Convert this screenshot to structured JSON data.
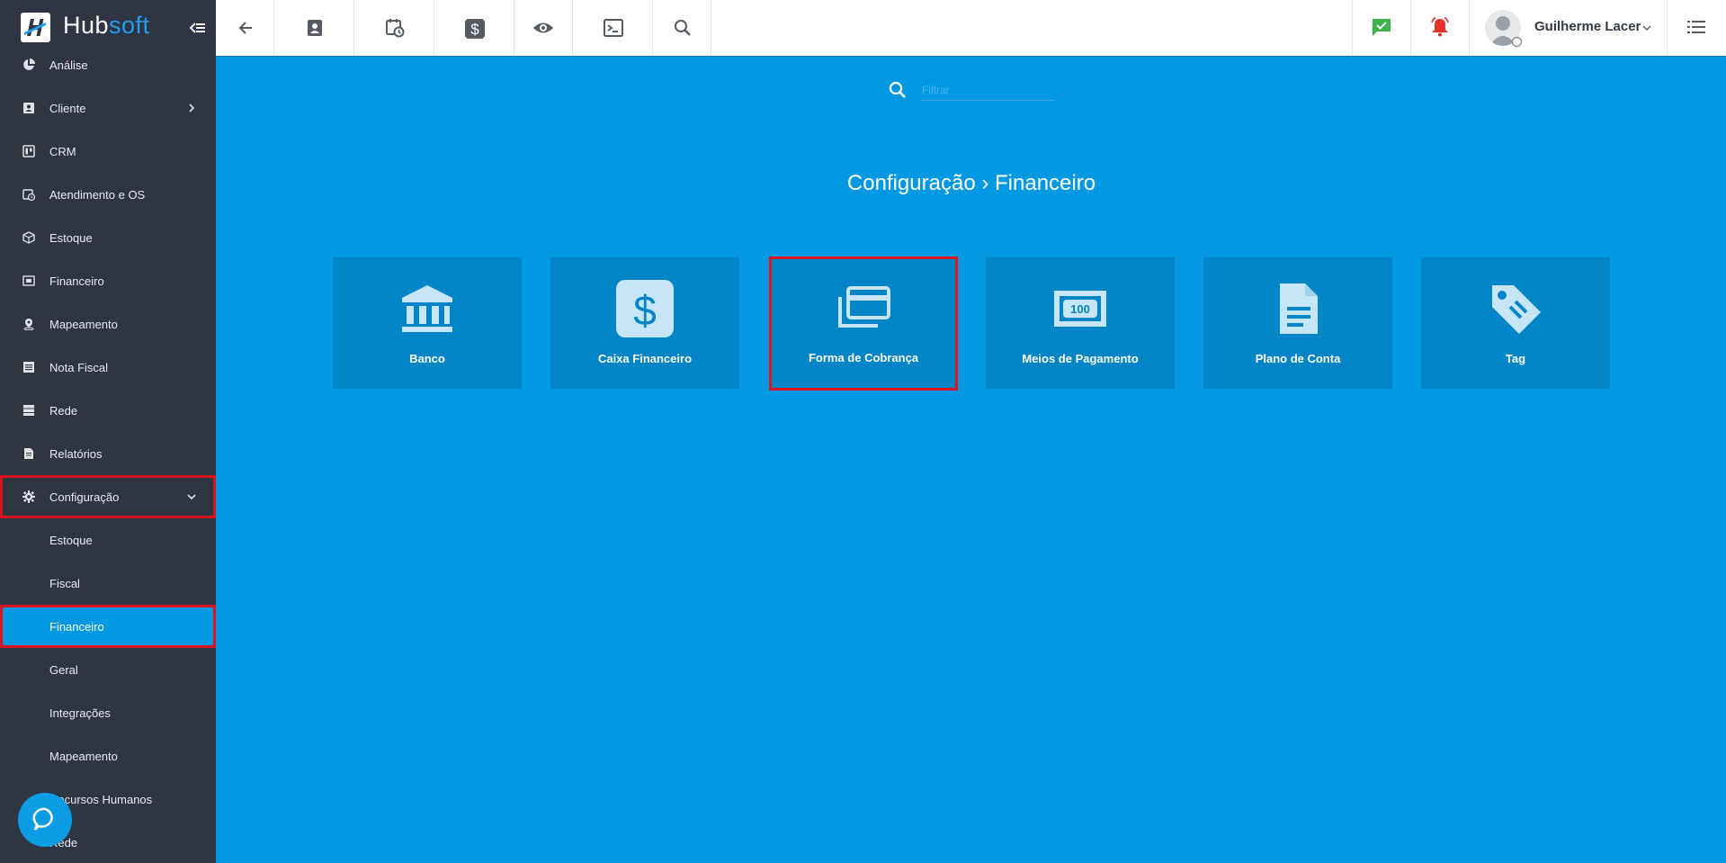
{
  "app": {
    "logo_hub": "Hub",
    "logo_soft": "soft"
  },
  "sidebar": {
    "items": [
      {
        "label": "Análise",
        "icon": "pie-chart-icon"
      },
      {
        "label": "Cliente",
        "icon": "contact-card-icon",
        "has_arrow": true
      },
      {
        "label": "CRM",
        "icon": "board-icon"
      },
      {
        "label": "Atendimento e OS",
        "icon": "calendar-clock-icon"
      },
      {
        "label": "Estoque",
        "icon": "box-icon"
      },
      {
        "label": "Financeiro",
        "icon": "money-icon"
      },
      {
        "label": "Mapeamento",
        "icon": "map-pin-icon"
      },
      {
        "label": "Nota Fiscal",
        "icon": "receipt-icon"
      },
      {
        "label": "Rede",
        "icon": "server-icon"
      },
      {
        "label": "Relatórios",
        "icon": "document-icon"
      },
      {
        "label": "Configuração",
        "icon": "gear-icon",
        "expanded": true
      }
    ],
    "sub_items": [
      {
        "label": "Estoque"
      },
      {
        "label": "Fiscal"
      },
      {
        "label": "Financeiro",
        "active": true
      },
      {
        "label": "Geral"
      },
      {
        "label": "Integrações"
      },
      {
        "label": "Mapeamento"
      },
      {
        "label": "Recursos Humanos"
      },
      {
        "label": "Rede"
      }
    ]
  },
  "topbar": {
    "user_name": "Guilherme Lacer",
    "icons": [
      "back-arrow-icon",
      "contact-card-icon",
      "calendar-clock-icon",
      "dollar-icon",
      "eye-icon",
      "terminal-icon",
      "search-icon"
    ],
    "right_icons": [
      "chat-check-icon",
      "alarm-bell-icon",
      "avatar",
      "chevron-down-icon",
      "list-menu-icon"
    ],
    "chat_color": "#3cb34a",
    "alarm_color": "#e8302a"
  },
  "main": {
    "filter_placeholder": "Filtrar",
    "breadcrumb_parent": "Configuração",
    "breadcrumb_separator": "›",
    "breadcrumb_current": "Financeiro",
    "cards": [
      {
        "label": "Banco",
        "icon": "bank-icon"
      },
      {
        "label": "Caixa Financeiro",
        "icon": "dollar-icon"
      },
      {
        "label": "Forma de Cobrança",
        "icon": "credit-cards-icon",
        "highlighted": true
      },
      {
        "label": "Meios de Pagamento",
        "icon": "banknote-100-icon"
      },
      {
        "label": "Plano de Conta",
        "icon": "document-icon"
      },
      {
        "label": "Tag",
        "icon": "tag-icon"
      }
    ]
  },
  "colors": {
    "accent": "#0398e2",
    "sidebar_bg": "#2f3542",
    "card_bg": "#0285c7",
    "highlight": "#d9151f"
  }
}
